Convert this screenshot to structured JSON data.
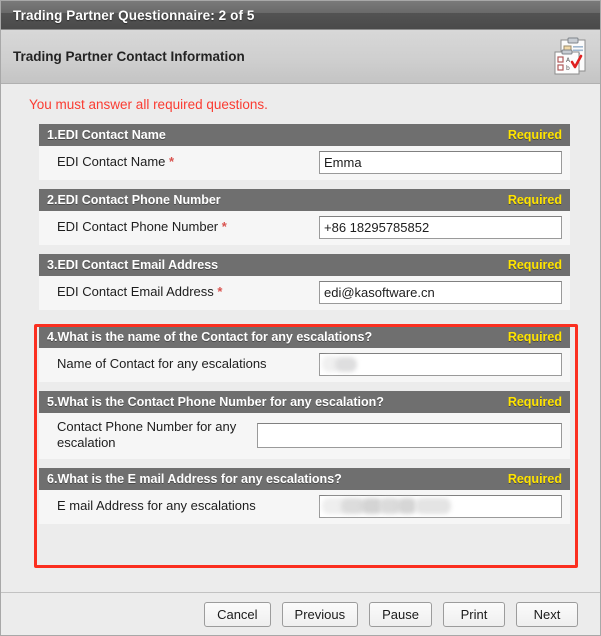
{
  "window": {
    "title": "Trading Partner Questionnaire: 2 of 5"
  },
  "header": {
    "subtitle": "Trading Partner Contact Information",
    "icon": "clipboard-checklist-icon"
  },
  "notice": {
    "text": "You must answer all required questions.",
    "color": "#fa3c32"
  },
  "colors": {
    "question_header_bg": "#6f6f6f",
    "required_label": "#ffe400",
    "annotation_outline": "#fb2f20"
  },
  "questions": [
    {
      "number": "1.",
      "title": "EDI Contact Name",
      "required_label": "Required",
      "field_label": "EDI Contact Name",
      "has_asterisk": true,
      "value": "Emma",
      "placeholder": "",
      "redacted": false
    },
    {
      "number": "2.",
      "title": "EDI Contact Phone Number",
      "required_label": "Required",
      "field_label": "EDI Contact Phone Number",
      "has_asterisk": true,
      "value": "+86 18295785852",
      "placeholder": "",
      "redacted": false
    },
    {
      "number": "3.",
      "title": "EDI Contact Email Address",
      "required_label": "Required",
      "field_label": "EDI Contact Email Address",
      "has_asterisk": true,
      "value": "edi@kasoftware.cn",
      "placeholder": "",
      "redacted": false
    },
    {
      "number": "4.",
      "title": "What is the name of the Contact for any escalations?",
      "required_label": "Required",
      "field_label": "Name of Contact for any escalations",
      "has_asterisk": false,
      "value": "",
      "placeholder": "",
      "redacted": true
    },
    {
      "number": "5.",
      "title": "What is the Contact Phone Number for any escalation?",
      "required_label": "Required",
      "field_label": "Contact Phone Number for any escalation",
      "has_asterisk": false,
      "value": "",
      "placeholder": "",
      "redacted": false
    },
    {
      "number": "6.",
      "title": "What is the E mail Address for any escalations?",
      "required_label": "Required",
      "field_label": "E mail Address for any escalations",
      "has_asterisk": false,
      "value": "",
      "placeholder": "",
      "redacted": true
    }
  ],
  "footer": {
    "buttons": [
      {
        "label": "Cancel"
      },
      {
        "label": "Previous"
      },
      {
        "label": "Pause"
      },
      {
        "label": "Print"
      },
      {
        "label": "Next"
      }
    ]
  }
}
